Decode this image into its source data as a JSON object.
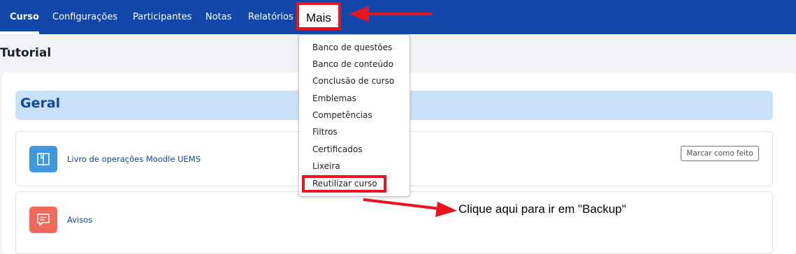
{
  "nav": {
    "items": [
      {
        "label": "Curso",
        "active": true
      },
      {
        "label": "Configurações"
      },
      {
        "label": "Participantes"
      },
      {
        "label": "Notas"
      },
      {
        "label": "Relatórios"
      }
    ],
    "more_label": "Mais"
  },
  "page": {
    "title": "Tutorial"
  },
  "section": {
    "title": "Geral"
  },
  "activities": [
    {
      "label": "Livro de operações Moodle UEMS",
      "icon": "book-icon",
      "done_button": "Marcar como feito"
    },
    {
      "label": "Avisos",
      "icon": "forum-icon"
    }
  ],
  "more_menu": {
    "items": [
      "Banco de questões",
      "Banco de conteúdo",
      "Conclusão de curso",
      "Emblemas",
      "Competências",
      "Filtros",
      "Certificados",
      "Lixeira",
      "Reutilizar curso"
    ]
  },
  "annotation": {
    "text": "Clique aqui para ir em \"Backup\""
  },
  "colors": {
    "navbar": "#1147a8",
    "highlight": "#e8141f",
    "section_header": "#c9e1f8",
    "book_icon": "#3e97df",
    "forum_icon": "#f2695c"
  }
}
